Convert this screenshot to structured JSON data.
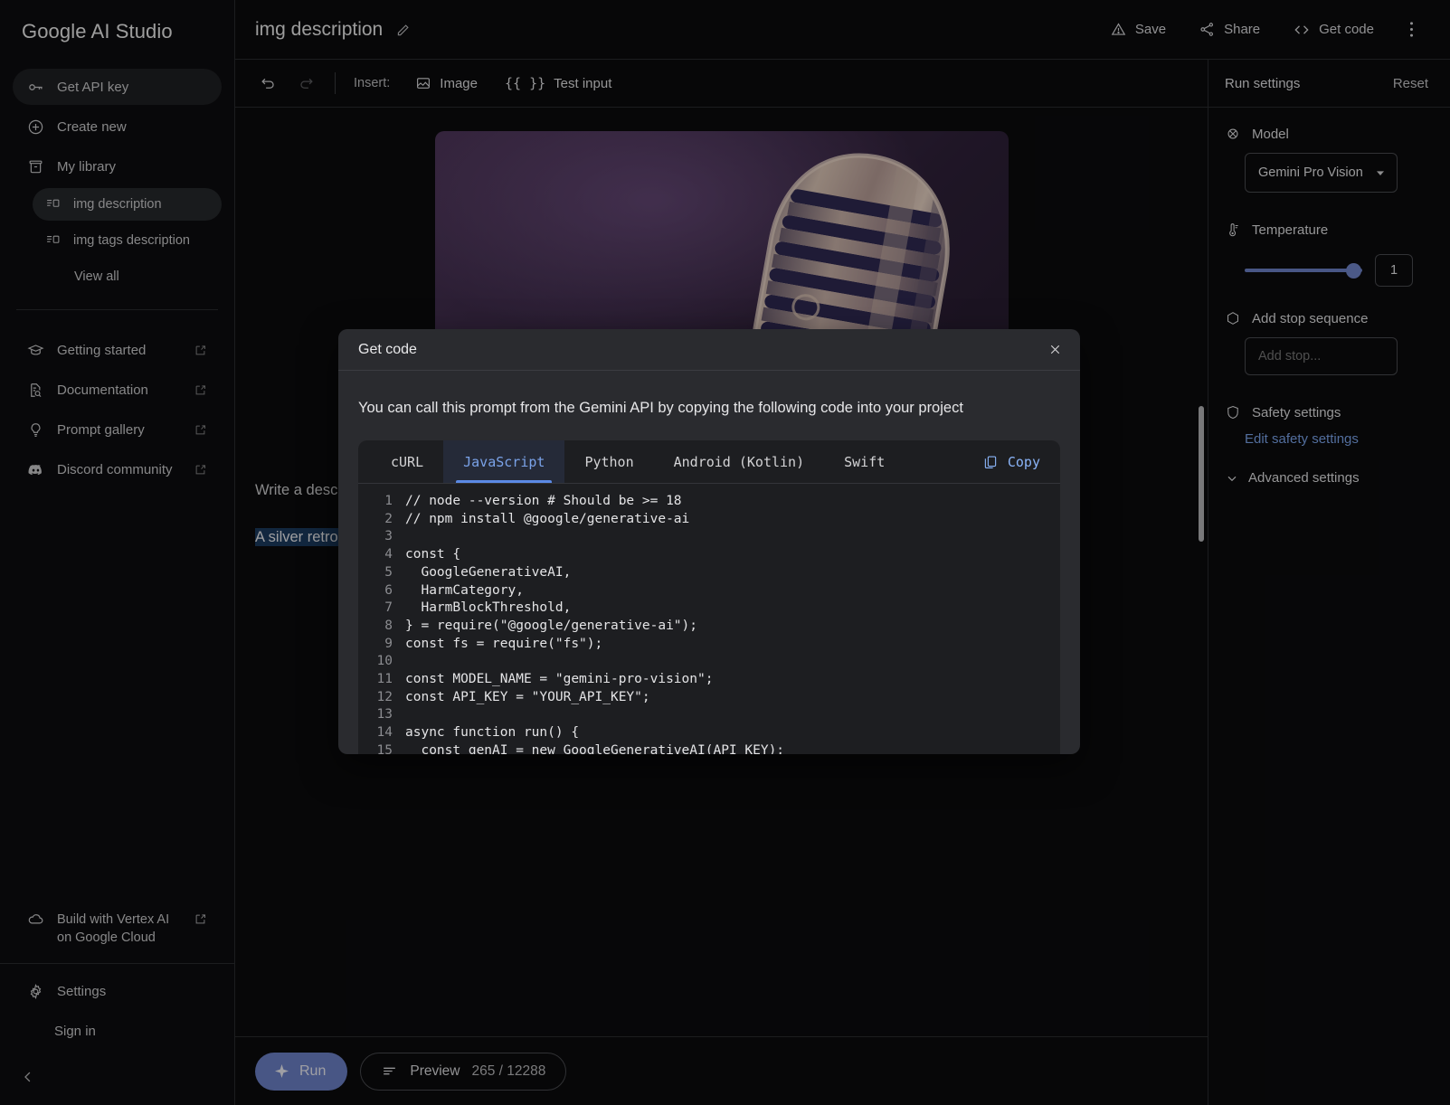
{
  "sidebar": {
    "brand": "Google AI Studio",
    "api_key_label": "Get API key",
    "create_new_label": "Create new",
    "my_library_label": "My library",
    "library_items": [
      {
        "label": "img description",
        "active": true
      },
      {
        "label": "img tags description",
        "active": false
      }
    ],
    "view_all_label": "View all",
    "links": [
      {
        "label": "Getting started",
        "external": true
      },
      {
        "label": "Documentation",
        "external": true
      },
      {
        "label": "Prompt gallery",
        "external": true
      },
      {
        "label": "Discord community",
        "external": true
      }
    ],
    "vertex_label": "Build with Vertex AI on Google Cloud",
    "settings_label": "Settings",
    "sign_in_label": "Sign in"
  },
  "header": {
    "doc_title": "img description",
    "save_label": "Save",
    "share_label": "Share",
    "get_code_label": "Get code"
  },
  "toolbar": {
    "insert_label": "Insert:",
    "image_label": "Image",
    "test_input_label": "Test input",
    "test_input_glyph": "{{ }}"
  },
  "prompt": {
    "instruction_text": "Write a descr",
    "response_text": "A silver retro"
  },
  "runbar": {
    "run_label": "Run",
    "preview_label": "Preview",
    "token_count": "265 / 12288"
  },
  "run_settings": {
    "title": "Run settings",
    "reset_label": "Reset",
    "model_label": "Model",
    "model_value": "Gemini Pro Vision",
    "temperature_label": "Temperature",
    "temperature_value": "1",
    "stop_sequence_label": "Add stop sequence",
    "stop_placeholder": "Add stop...",
    "safety_label": "Safety settings",
    "edit_safety_label": "Edit safety settings",
    "advanced_label": "Advanced settings"
  },
  "modal": {
    "title": "Get code",
    "description": "You can call this prompt from the Gemini API by copying the following code into your project",
    "copy_label": "Copy",
    "tabs": [
      {
        "label": "cURL",
        "active": false
      },
      {
        "label": "JavaScript",
        "active": true
      },
      {
        "label": "Python",
        "active": false
      },
      {
        "label": "Android (Kotlin)",
        "active": false
      },
      {
        "label": "Swift",
        "active": false
      }
    ],
    "code_lines": [
      {
        "n": "1",
        "t": "// node --version # Should be >= 18"
      },
      {
        "n": "2",
        "t": "// npm install @google/generative-ai"
      },
      {
        "n": "3",
        "t": ""
      },
      {
        "n": "4",
        "t": "const {"
      },
      {
        "n": "5",
        "t": "  GoogleGenerativeAI,"
      },
      {
        "n": "6",
        "t": "  HarmCategory,"
      },
      {
        "n": "7",
        "t": "  HarmBlockThreshold,"
      },
      {
        "n": "8",
        "t": "} = require(\"@google/generative-ai\");"
      },
      {
        "n": "9",
        "t": "const fs = require(\"fs\");"
      },
      {
        "n": "10",
        "t": ""
      },
      {
        "n": "11",
        "t": "const MODEL_NAME = \"gemini-pro-vision\";"
      },
      {
        "n": "12",
        "t": "const API_KEY = \"YOUR_API_KEY\";"
      },
      {
        "n": "13",
        "t": ""
      },
      {
        "n": "14",
        "t": "async function run() {"
      },
      {
        "n": "15",
        "t": "  const genAI = new GoogleGenerativeAI(API_KEY);"
      }
    ]
  },
  "colors": {
    "accent_blue": "#6a7fc4",
    "link_blue": "#7aa2e8",
    "copy_blue": "#8ab4f8",
    "selection_blue": "#1b3a5e",
    "background": "#0b0b0d",
    "modal_bg": "#2a2b2f",
    "code_bg": "#1d1e21"
  }
}
